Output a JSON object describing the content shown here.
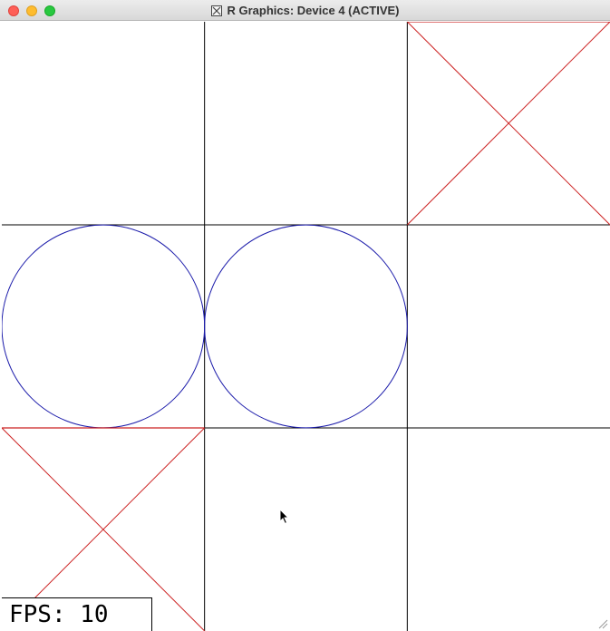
{
  "window": {
    "title": "R Graphics: Device 4 (ACTIVE)",
    "buttons": [
      "close",
      "minimize",
      "zoom"
    ],
    "app_icon": "x11-icon"
  },
  "board": {
    "rows": 3,
    "cols": 3,
    "cells": [
      [
        "",
        "",
        "X"
      ],
      [
        "O",
        "O",
        ""
      ],
      [
        "X",
        "",
        ""
      ]
    ],
    "colors": {
      "grid": "#000000",
      "x_mark": "#cc2222",
      "o_mark": "#1a1aaa"
    }
  },
  "fps": {
    "text": "FPS: 10"
  },
  "cursor": "arrow-pointer"
}
